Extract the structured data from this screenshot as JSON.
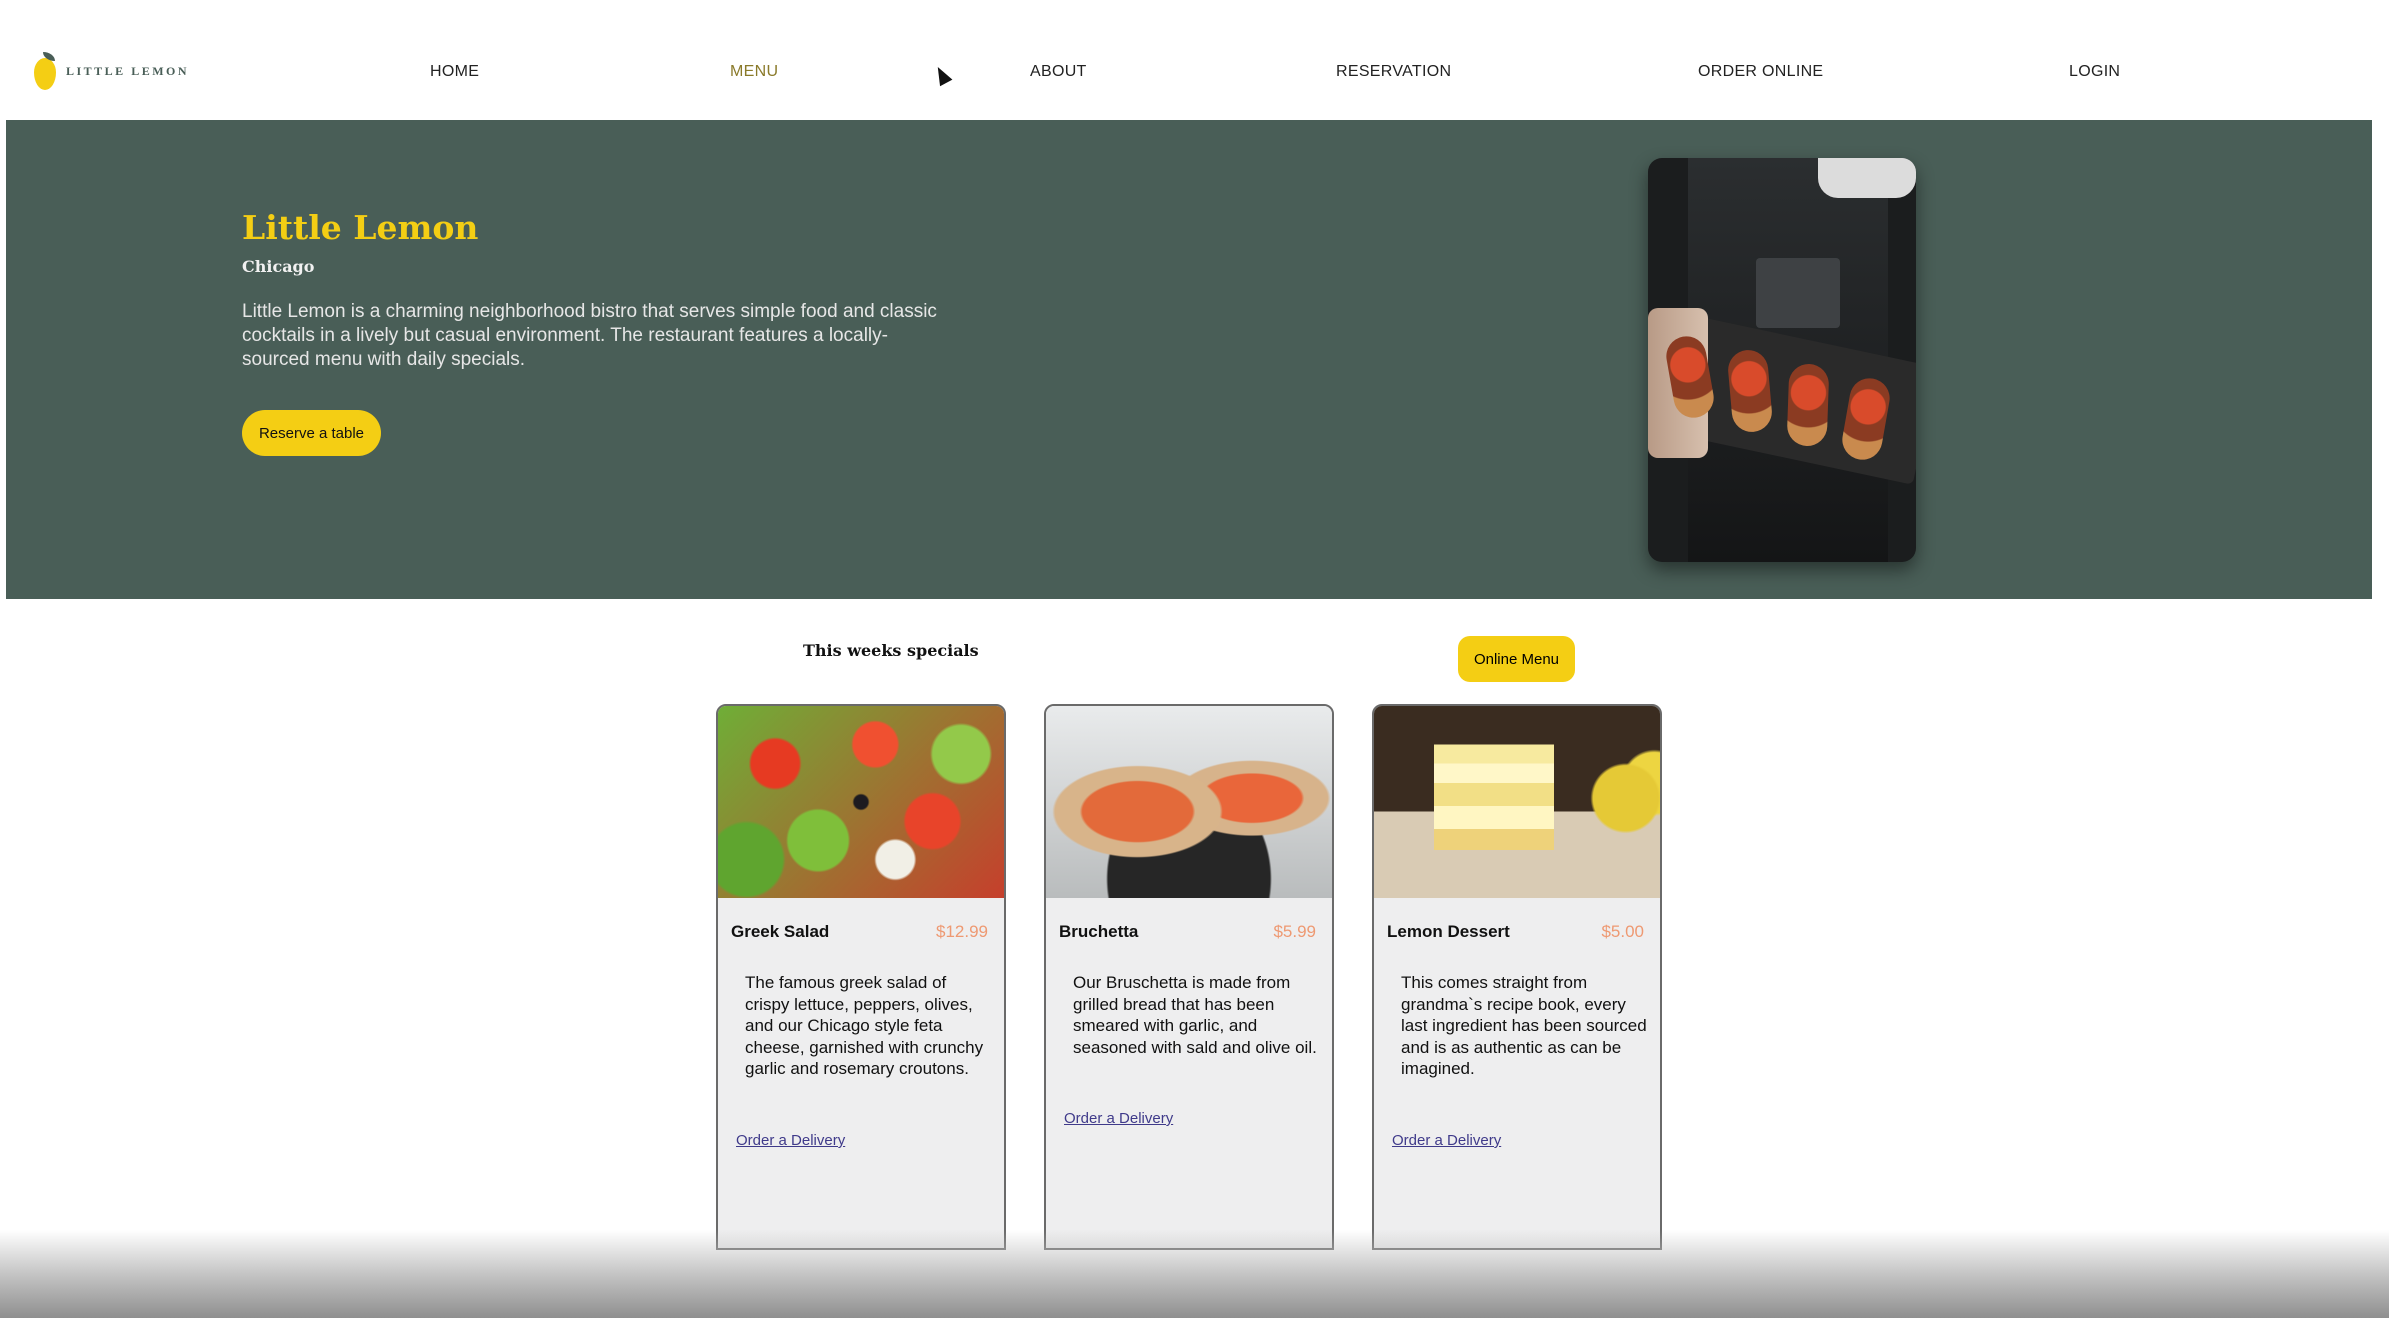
{
  "nav": {
    "logo_text": "LITTLE LEMON",
    "links": [
      "HOME",
      "MENU",
      "ABOUT",
      "RESERVATION",
      "ORDER ONLINE",
      "LOGIN"
    ],
    "active": "MENU"
  },
  "hero": {
    "title": "Little Lemon",
    "city": "Chicago",
    "description": "Little Lemon is a charming neighborhood bistro that serves simple food and classic cocktails in a lively but casual environment. The restaurant features a locally-sourced menu with daily specials.",
    "button": "Reserve a table"
  },
  "specials": {
    "title": "This weeks specials",
    "online_menu": "Online Menu",
    "cards": [
      {
        "name": "Greek Salad",
        "price": "$12.99",
        "description": "The famous greek salad of crispy lettuce, peppers, olives, and our Chicago style feta cheese, garnished with crunchy garlic and rosemary croutons.",
        "link": "Order a Delivery"
      },
      {
        "name": "Bruchetta",
        "price": "$5.99",
        "description": "Our Bruschetta is made from grilled bread that has been smeared with garlic, and seasoned with sald and olive oil.",
        "link": "Order a Delivery"
      },
      {
        "name": "Lemon Dessert",
        "price": "$5.00",
        "description": "This comes straight from grandma`s recipe book, every last ingredient has been sourced and is as authentic as can be imagined.",
        "link": "Order a Delivery"
      }
    ]
  },
  "colors": {
    "primary_green": "#495E57",
    "primary_yellow": "#F4CE14",
    "price_salmon": "#EE9972",
    "card_bg": "#EEEEEF"
  }
}
